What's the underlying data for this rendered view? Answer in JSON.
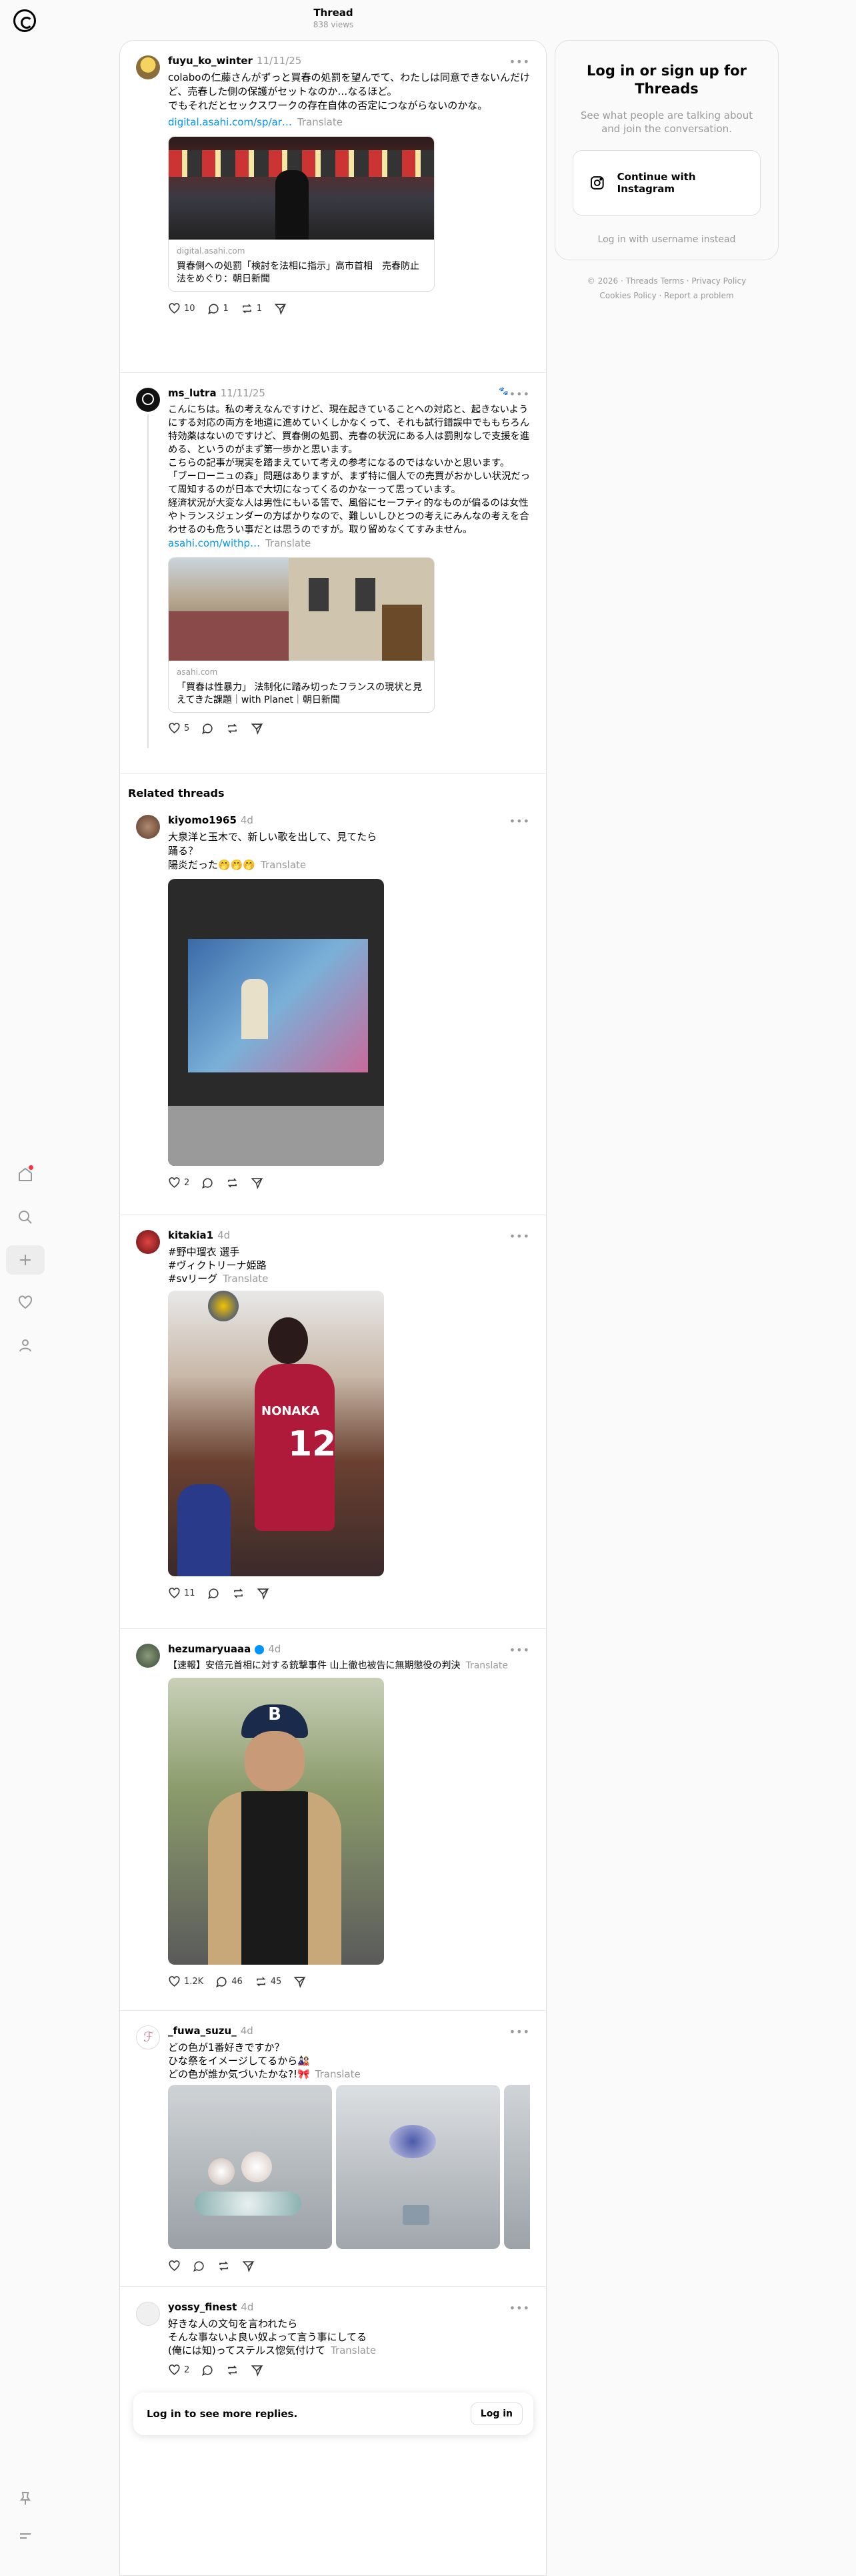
{
  "header": {
    "title": "Thread",
    "views": "838 views"
  },
  "posts": [
    {
      "username": "fuyu_ko_winter",
      "time": "11/11/25",
      "text": "colaboの仁藤さんがずっと買春の処罰を望んでて、わたしは同意できないんだけど、売春した側の保護がセットなのか…なるほど。\nでもそれだとセックスワークの存在自体の否定につながらないのかな。",
      "link": "digital.asahi.com/sp/ar…",
      "translate": "Translate",
      "card_source": "digital.asahi.com",
      "card_title": "買春側への処罰「検討を法相に指示」高市首相　売春防止法をめぐり：朝日新聞",
      "likes": "10",
      "replies": "1",
      "reposts": "1"
    },
    {
      "username": "ms_lutra",
      "time": "11/11/25",
      "text": "こんにちは。私の考えなんですけど、現在起きていることへの対応と、起きないようにする対応の両方を地道に進めていくしかなくって、それも試行錯誤中でももちろん特効薬はないのですけど、買春側の処罰、売春の状況にある人は罰則なしで支援を進める、というのがまず第一歩かと思います。\nこちらの記事が現実を踏まえていて考えの参考になるのではないかと思います。\n「ブーローニュの森」問題はありますが、まず特に個人での売買がおかしい状況だって周知するのが日本で大切になってくるのかなーって思っています。\n経済状況が大変な人は男性にもいる筈で、風俗にセーフティ的なものが偏るのは女性やトランスジェンダーの方ばかりなので、難しいしひとつの考えにみんなの考えを合わせるのも危うい事だとは思うのですが。取り留めなくてすみません。",
      "link": "asahi.com/withp…",
      "translate": "Translate",
      "card_source": "asahi.com",
      "card_title": "「買春は性暴力」 法制化に踏み切ったフランスの現状と見えてきた課題｜with Planet｜朝日新聞",
      "likes": "5"
    }
  ],
  "related_title": "Related threads",
  "related": [
    {
      "username": "kiyomo1965",
      "time": "4d",
      "text": "大泉洋と玉木で、新しい歌を出して、見てたら\n踊る？\n陽炎だった🤭🤭🤭",
      "translate": "Translate",
      "likes": "2"
    },
    {
      "username": "kitakia1",
      "time": "4d",
      "text": "#野中瑠衣 選手\n#ヴィクトリーナ姫路\n#svリーグ",
      "translate": "Translate",
      "likes": "11",
      "jersey": "NONAKA",
      "number": "12"
    },
    {
      "username": "hezumaryuaaa",
      "time": "4d",
      "text": "【速報】安倍元首相に対する銃撃事件 山上徹也被告に無期懲役の判決",
      "translate": "Translate",
      "likes": "1.2K",
      "replies": "46",
      "reposts": "45",
      "cap": "B"
    },
    {
      "username": "_fuwa_suzu_",
      "time": "4d",
      "text": "どの色が1番好きですか？\nひな祭をイメージしてるから🎎\nどの色が誰か気づいたかな?!🎀",
      "translate": "Translate"
    },
    {
      "username": "yossy_finest",
      "time": "4d",
      "text": "好きな人の文句を言われたら\nそんな事ないよ良い奴よって言う事にしてる\n(俺には知)ってステルス惚気付けて",
      "translate": "Translate",
      "likes": "2"
    }
  ],
  "login_bar": {
    "message": "Log in to see more replies.",
    "button": "Log in"
  },
  "right": {
    "title": "Log in or sign up for Threads",
    "subtitle": "See what people are talking about and join the conversation.",
    "ig_button": "Continue with Instagram",
    "username_link": "Log in with username instead",
    "footer1": "© 2026 · Threads Terms · Privacy Policy",
    "footer2": "Cookies Policy · Report a problem"
  },
  "icons": {
    "nav": [
      "home-icon",
      "search-icon",
      "create-icon",
      "heart-icon",
      "profile-icon",
      "pin-icon",
      "menu-icon"
    ]
  },
  "colors": {
    "link": "#0095f6",
    "verified": "#0095f6",
    "notification": "#ff3040"
  }
}
